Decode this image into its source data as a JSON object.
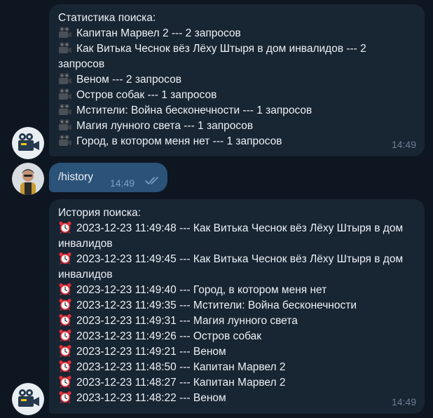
{
  "messages": {
    "stats": {
      "title": "Статистика поиска:",
      "lines": [
        "Капитан Марвел 2 --- 2 запросов",
        "Как Витька Чеснок вёз Лёху Штыря в дом инвалидов --- 2 запросов",
        "Веном --- 2 запросов",
        "Остров собак --- 1 запросов",
        "Мстители: Война бесконечности --- 1 запросов",
        "Магия лунного света --- 1 запросов",
        "Город, в котором меня нет --- 1 запросов"
      ],
      "line_icon": "film-camera-icon",
      "time": "14:49"
    },
    "command": {
      "text": "/history",
      "time": "14:49",
      "status_icon": "double-check-icon"
    },
    "history": {
      "title": "История поиска:",
      "lines": [
        "2023-12-23 11:49:48 --- Как Витька Чеснок вёз Лёху Штыря в дом инвалидов",
        "2023-12-23 11:49:45 --- Как Витька Чеснок вёз Лёху Штыря в дом инвалидов",
        "2023-12-23 11:49:40 --- Город, в котором меня нет",
        "2023-12-23 11:49:35 --- Мстители: Война бесконечности",
        "2023-12-23 11:49:31 --- Магия лунного света",
        "2023-12-23 11:49:26 --- Остров собак",
        "2023-12-23 11:49:21 --- Веном",
        "2023-12-23 11:48:50 --- Капитан Марвел 2",
        "2023-12-23 11:48:27 --- Капитан Марвел 2",
        "2023-12-23 11:48:22 --- Веном"
      ],
      "line_icon": "alarm-clock-icon",
      "time": "14:49"
    }
  },
  "colors": {
    "background": "#0e1621",
    "incoming_bubble": "#182533",
    "outgoing_bubble": "#2b5278",
    "timestamp": "#6c7f92",
    "check": "#7ba3c6"
  }
}
